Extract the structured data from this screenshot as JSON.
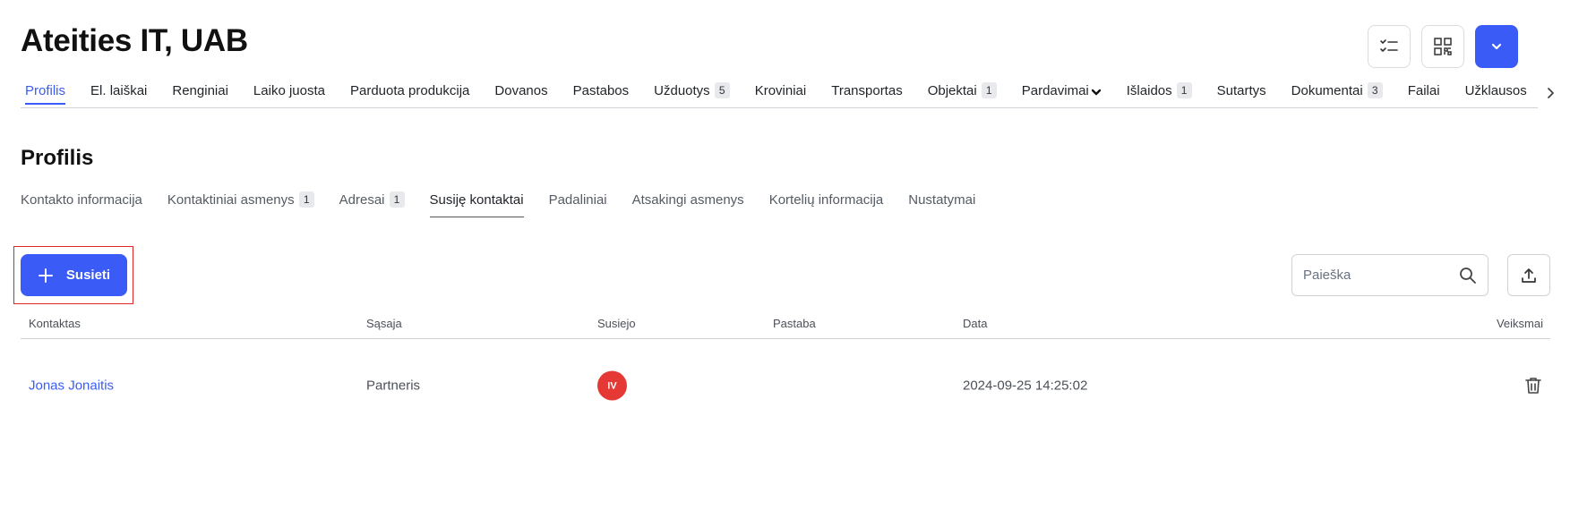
{
  "company": {
    "title": "Ateities IT, UAB"
  },
  "top_actions": [
    {
      "name": "checklist-icon"
    },
    {
      "name": "qr-code-icon"
    },
    {
      "name": "chevron-down-icon"
    }
  ],
  "main_tabs": [
    {
      "label": "Profilis",
      "active": true
    },
    {
      "label": "El. laiškai"
    },
    {
      "label": "Renginiai"
    },
    {
      "label": "Laiko juosta"
    },
    {
      "label": "Parduota produkcija"
    },
    {
      "label": "Dovanos"
    },
    {
      "label": "Pastabos"
    },
    {
      "label": "Užduotys",
      "badge": "5"
    },
    {
      "label": "Kroviniai"
    },
    {
      "label": "Transportas"
    },
    {
      "label": "Objektai",
      "badge": "1"
    },
    {
      "label": "Pardavimai",
      "dropdown": true
    },
    {
      "label": "Išlaidos",
      "badge": "1"
    },
    {
      "label": "Sutartys"
    },
    {
      "label": "Dokumentai",
      "badge": "3"
    },
    {
      "label": "Failai"
    },
    {
      "label": "Užklausos"
    }
  ],
  "section": {
    "title": "Profilis"
  },
  "sub_tabs": [
    {
      "label": "Kontakto informacija"
    },
    {
      "label": "Kontaktiniai asmenys",
      "badge": "1"
    },
    {
      "label": "Adresai",
      "badge": "1"
    },
    {
      "label": "Susiję kontaktai",
      "active": true
    },
    {
      "label": "Padaliniai"
    },
    {
      "label": "Atsakingi asmenys"
    },
    {
      "label": "Kortelių informacija"
    },
    {
      "label": "Nustatymai"
    }
  ],
  "toolbar": {
    "link_label": "Susieti",
    "search_placeholder": "Paieška"
  },
  "table": {
    "headers": {
      "contact": "Kontaktas",
      "relation": "Sąsaja",
      "linked_by": "Susiejo",
      "note": "Pastaba",
      "date": "Data",
      "actions": "Veiksmai"
    },
    "rows": [
      {
        "contact": "Jonas Jonaitis",
        "relation": "Partneris",
        "linked_by_initials": "IV",
        "note": "",
        "date": "2024-09-25 14:25:02"
      }
    ]
  },
  "colors": {
    "accent": "#3b5bf6",
    "avatar": "#e53935",
    "highlight_frame": "#e02424"
  }
}
